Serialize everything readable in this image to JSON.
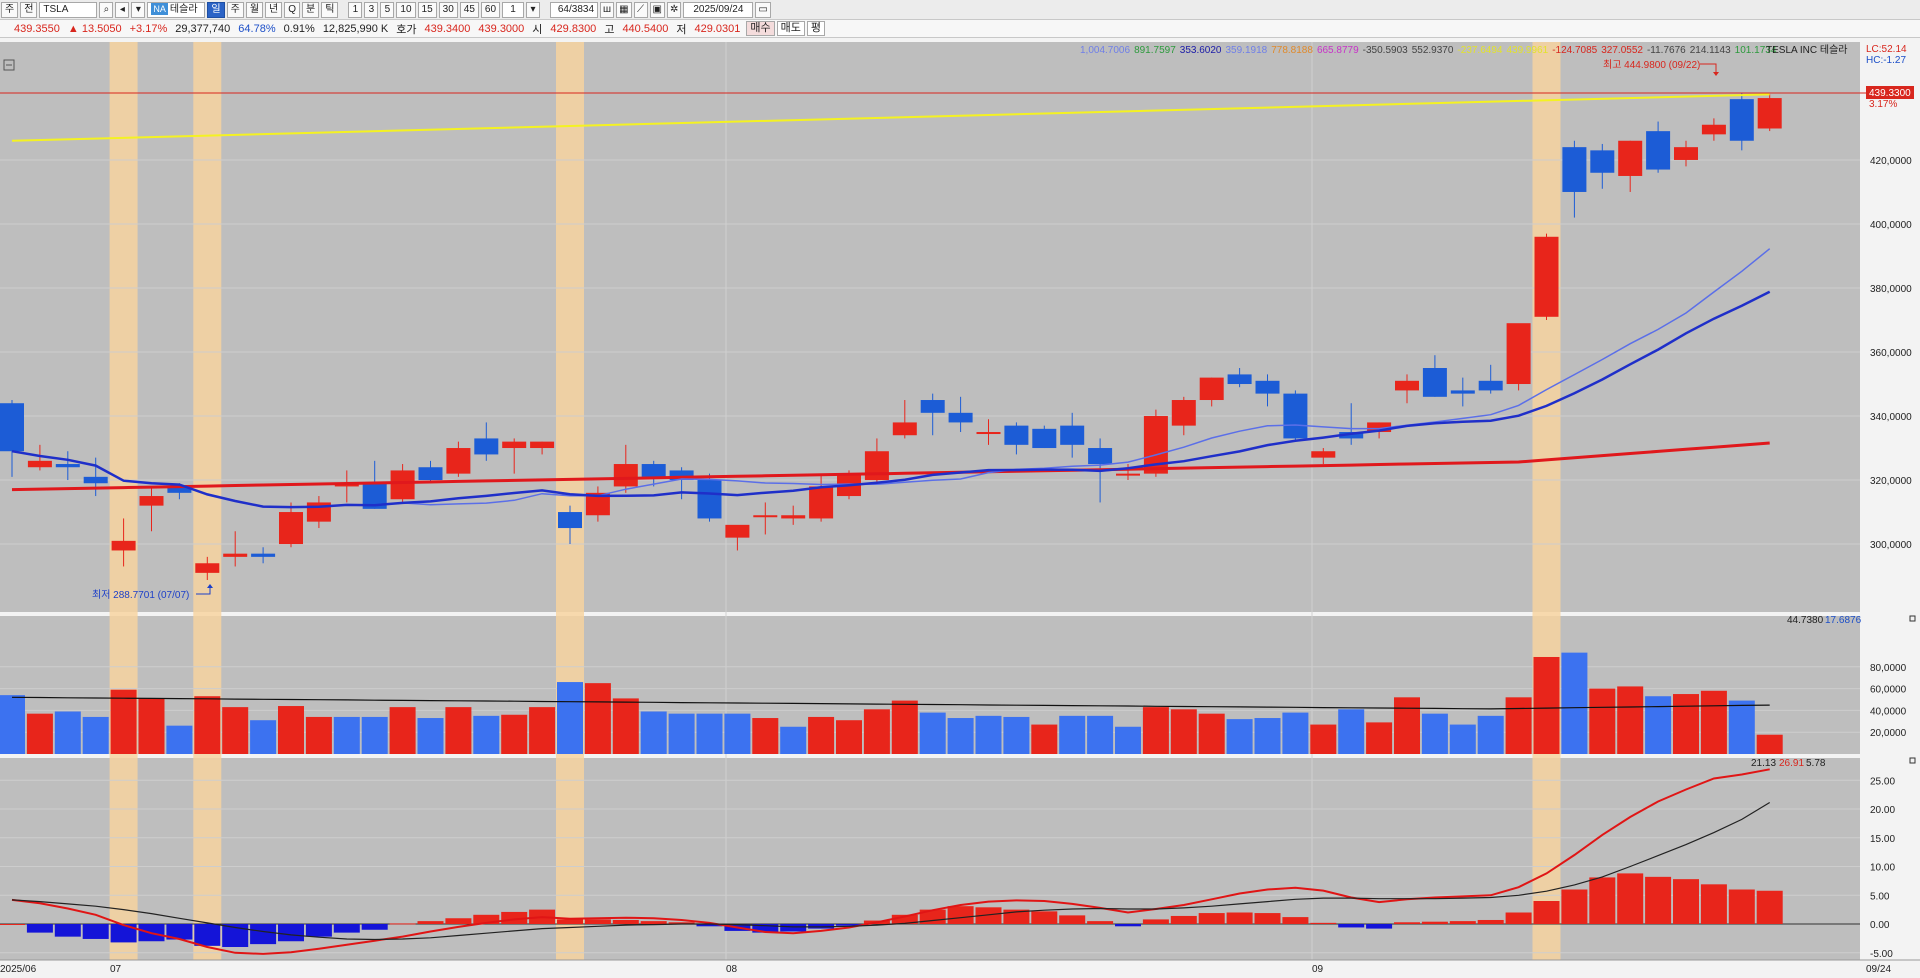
{
  "toolbar": {
    "period_type": "주",
    "prev": "전",
    "symbol": "TSLA",
    "na_badge": "NA",
    "stock_name": "테슬라",
    "periods": [
      "일",
      "주",
      "월",
      "년",
      "Q",
      "분",
      "틱"
    ],
    "active_period": "일",
    "minute_steps": [
      "1",
      "3",
      "5",
      "10",
      "15",
      "30",
      "45",
      "60"
    ],
    "step_value": "1",
    "counter": "64",
    "total": "/3834",
    "date": "2025/09/24"
  },
  "quote": {
    "price": "439.3550",
    "change": "▲ 13.5050",
    "change_pct": "+3.17%",
    "volume": "29,377,740",
    "volume_pct": "64.78%",
    "turnover_pct": "0.91%",
    "amount": "12,825,990 K",
    "hoga_label": "호가",
    "ask": "439.3400",
    "bid": "439.3000",
    "open_label": "시",
    "open": "429.8300",
    "high_label": "고",
    "high": "440.5400",
    "low_label": "저",
    "low": "429.0301",
    "buy_label": "매수",
    "sell_label": "매도",
    "avg_label": "평"
  },
  "legend": {
    "values": [
      {
        "text": "1,004.7006",
        "color": "#6f7fe8"
      },
      {
        "text": "891.7597",
        "color": "#2c9a3c"
      },
      {
        "text": "353.6020",
        "color": "#1b1ba8"
      },
      {
        "text": "359.1918",
        "color": "#6f7fe8"
      },
      {
        "text": "778.8188",
        "color": "#e08a2b"
      },
      {
        "text": "665.8779",
        "color": "#c833c8"
      },
      {
        "text": "-350.5903",
        "color": "#444444"
      },
      {
        "text": "552.9370",
        "color": "#444444"
      },
      {
        "text": "-237.6494",
        "color": "#e3e32b"
      },
      {
        "text": "439.9961",
        "color": "#e3e32b"
      },
      {
        "text": "-124.7085",
        "color": "#d8261d"
      },
      {
        "text": "327.0552",
        "color": "#d8261d"
      },
      {
        "text": "-11.7676",
        "color": "#444444"
      },
      {
        "text": "214.1143",
        "color": "#444444"
      },
      {
        "text": "101.1734",
        "color": "#2c9a3c"
      }
    ],
    "name": "TESLA INC  테슬라",
    "lc": "LC:52.14",
    "hc": "HC:-1.27"
  },
  "price_panel": {
    "y_ticks": [
      "420,0000",
      "400,0000",
      "380,0000",
      "360,0000",
      "340,0000",
      "320,0000",
      "300,0000"
    ],
    "current_price": "439.3300",
    "current_pct": "3.17%",
    "high_note": "최고 444.9800 (09/22)",
    "low_note": "최저 288.7701 (07/07)"
  },
  "volume_panel": {
    "header_a": "44.7380",
    "header_b": "17.6876",
    "y_ticks": [
      "80,0000",
      "60,0000",
      "40,0000",
      "20,0000"
    ]
  },
  "macd_panel": {
    "header_a": "21.13",
    "header_b": "26.91",
    "header_c": "5.78",
    "y_ticks": [
      "25.00",
      "20.00",
      "15.00",
      "10.00",
      "5.00",
      "0.00",
      "-5.00"
    ]
  },
  "x_labels": [
    "2025/06",
    "07",
    "08",
    "09",
    "09/24"
  ],
  "colors": {
    "up": "#e8251b",
    "down": "#1c5cd6",
    "vol_down": "#3c72f0",
    "highlight": "#f7d3a0",
    "background": "#bfbfbf",
    "ma_red": "#e0181c",
    "ma_blue": "#1f2fc9",
    "ma_light": "#5b6fe8",
    "ma_yellow": "#f4f222"
  },
  "chart_data": {
    "type": "candlestick",
    "candles": [
      {
        "o": 344,
        "h": 345,
        "l": 321,
        "c": 329
      },
      {
        "o": 324,
        "h": 331,
        "l": 323,
        "c": 326
      },
      {
        "o": 325,
        "h": 329,
        "l": 320,
        "c": 324
      },
      {
        "o": 321,
        "h": 327,
        "l": 315,
        "c": 319
      },
      {
        "o": 298,
        "h": 308,
        "l": 293,
        "c": 301
      },
      {
        "o": 312,
        "h": 318,
        "l": 304,
        "c": 315
      },
      {
        "o": 318,
        "h": 319,
        "l": 314,
        "c": 316
      },
      {
        "o": 291,
        "h": 296,
        "l": 288.77,
        "c": 294
      },
      {
        "o": 296,
        "h": 304,
        "l": 293,
        "c": 297
      },
      {
        "o": 297,
        "h": 299,
        "l": 294,
        "c": 296
      },
      {
        "o": 300,
        "h": 313,
        "l": 299,
        "c": 310
      },
      {
        "o": 307,
        "h": 315,
        "l": 305,
        "c": 313
      },
      {
        "o": 318,
        "h": 323,
        "l": 313,
        "c": 319
      },
      {
        "o": 319,
        "h": 326,
        "l": 311,
        "c": 311
      },
      {
        "o": 314,
        "h": 325,
        "l": 313,
        "c": 323
      },
      {
        "o": 324,
        "h": 326,
        "l": 319,
        "c": 320
      },
      {
        "o": 322,
        "h": 332,
        "l": 321,
        "c": 330
      },
      {
        "o": 333,
        "h": 338,
        "l": 326,
        "c": 328
      },
      {
        "o": 330,
        "h": 333,
        "l": 322,
        "c": 332
      },
      {
        "o": 330,
        "h": 332,
        "l": 328,
        "c": 332
      },
      {
        "o": 310,
        "h": 312,
        "l": 300,
        "c": 305
      },
      {
        "o": 309,
        "h": 318,
        "l": 307,
        "c": 316
      },
      {
        "o": 318,
        "h": 331,
        "l": 316,
        "c": 325
      },
      {
        "o": 325,
        "h": 326,
        "l": 318,
        "c": 321
      },
      {
        "o": 323,
        "h": 324,
        "l": 314,
        "c": 320
      },
      {
        "o": 320,
        "h": 322,
        "l": 307,
        "c": 308
      },
      {
        "o": 302,
        "h": 305,
        "l": 298,
        "c": 306
      },
      {
        "o": 309,
        "h": 313,
        "l": 303,
        "c": 309
      },
      {
        "o": 308,
        "h": 312,
        "l": 306,
        "c": 309
      },
      {
        "o": 308,
        "h": 322,
        "l": 307,
        "c": 318
      },
      {
        "o": 315,
        "h": 323,
        "l": 314,
        "c": 322
      },
      {
        "o": 320,
        "h": 333,
        "l": 319,
        "c": 329
      },
      {
        "o": 334,
        "h": 345,
        "l": 333,
        "c": 338
      },
      {
        "o": 345,
        "h": 347,
        "l": 334,
        "c": 341
      },
      {
        "o": 341,
        "h": 346,
        "l": 335,
        "c": 338
      },
      {
        "o": 335,
        "h": 339,
        "l": 331,
        "c": 335
      },
      {
        "o": 337,
        "h": 338,
        "l": 328,
        "c": 331
      },
      {
        "o": 336,
        "h": 337,
        "l": 330,
        "c": 330
      },
      {
        "o": 337,
        "h": 341,
        "l": 327,
        "c": 331
      },
      {
        "o": 330,
        "h": 333,
        "l": 313,
        "c": 325
      },
      {
        "o": 322,
        "h": 325,
        "l": 320,
        "c": 322
      },
      {
        "o": 322,
        "h": 342,
        "l": 321,
        "c": 340
      },
      {
        "o": 337,
        "h": 346,
        "l": 334,
        "c": 345
      },
      {
        "o": 345,
        "h": 352,
        "l": 343,
        "c": 352
      },
      {
        "o": 353,
        "h": 355,
        "l": 349,
        "c": 350
      },
      {
        "o": 351,
        "h": 353,
        "l": 343,
        "c": 347
      },
      {
        "o": 347,
        "h": 348,
        "l": 332,
        "c": 333
      },
      {
        "o": 327,
        "h": 330,
        "l": 325,
        "c": 329
      },
      {
        "o": 335,
        "h": 344,
        "l": 331,
        "c": 333
      },
      {
        "o": 335,
        "h": 338,
        "l": 333,
        "c": 338
      },
      {
        "o": 348,
        "h": 353,
        "l": 344,
        "c": 351
      },
      {
        "o": 355,
        "h": 359,
        "l": 346,
        "c": 346
      },
      {
        "o": 348,
        "h": 352,
        "l": 343,
        "c": 347
      },
      {
        "o": 351,
        "h": 356,
        "l": 347,
        "c": 348
      },
      {
        "o": 350,
        "h": 357,
        "l": 348,
        "c": 369
      },
      {
        "o": 371,
        "h": 397,
        "l": 370,
        "c": 396
      },
      {
        "o": 424,
        "h": 426,
        "l": 402,
        "c": 410
      },
      {
        "o": 423,
        "h": 425,
        "l": 411,
        "c": 416
      },
      {
        "o": 415,
        "h": 426,
        "l": 410,
        "c": 426
      },
      {
        "o": 429,
        "h": 432,
        "l": 416,
        "c": 417
      },
      {
        "o": 420,
        "h": 426,
        "l": 418,
        "c": 424
      },
      {
        "o": 428,
        "h": 433,
        "l": 426,
        "c": 431
      },
      {
        "o": 439,
        "h": 441,
        "l": 423,
        "c": 426
      },
      {
        "o": 429.83,
        "h": 440.54,
        "l": 429.03,
        "c": 439.33
      }
    ],
    "volume": [
      {
        "v": 54,
        "up": false
      },
      {
        "v": 37,
        "up": true
      },
      {
        "v": 39,
        "up": false
      },
      {
        "v": 34,
        "up": false
      },
      {
        "v": 59,
        "up": true
      },
      {
        "v": 51,
        "up": true
      },
      {
        "v": 26,
        "up": false
      },
      {
        "v": 53,
        "up": true
      },
      {
        "v": 43,
        "up": true
      },
      {
        "v": 31,
        "up": false
      },
      {
        "v": 44,
        "up": true
      },
      {
        "v": 34,
        "up": true
      },
      {
        "v": 34,
        "up": false
      },
      {
        "v": 34,
        "up": false
      },
      {
        "v": 43,
        "up": true
      },
      {
        "v": 33,
        "up": false
      },
      {
        "v": 43,
        "up": true
      },
      {
        "v": 35,
        "up": false
      },
      {
        "v": 36,
        "up": true
      },
      {
        "v": 43,
        "up": true
      },
      {
        "v": 66,
        "up": false
      },
      {
        "v": 65,
        "up": true
      },
      {
        "v": 51,
        "up": true
      },
      {
        "v": 39,
        "up": false
      },
      {
        "v": 37,
        "up": false
      },
      {
        "v": 37,
        "up": false
      },
      {
        "v": 37,
        "up": false
      },
      {
        "v": 33,
        "up": true
      },
      {
        "v": 25,
        "up": false
      },
      {
        "v": 34,
        "up": true
      },
      {
        "v": 31,
        "up": true
      },
      {
        "v": 41,
        "up": true
      },
      {
        "v": 49,
        "up": true
      },
      {
        "v": 38,
        "up": false
      },
      {
        "v": 33,
        "up": false
      },
      {
        "v": 35,
        "up": false
      },
      {
        "v": 34,
        "up": false
      },
      {
        "v": 27,
        "up": true
      },
      {
        "v": 35,
        "up": false
      },
      {
        "v": 35,
        "up": false
      },
      {
        "v": 25,
        "up": false
      },
      {
        "v": 43,
        "up": true
      },
      {
        "v": 41,
        "up": true
      },
      {
        "v": 37,
        "up": true
      },
      {
        "v": 32,
        "up": false
      },
      {
        "v": 33,
        "up": false
      },
      {
        "v": 38,
        "up": false
      },
      {
        "v": 27,
        "up": true
      },
      {
        "v": 41,
        "up": false
      },
      {
        "v": 29,
        "up": true
      },
      {
        "v": 52,
        "up": true
      },
      {
        "v": 37,
        "up": false
      },
      {
        "v": 27,
        "up": false
      },
      {
        "v": 35,
        "up": false
      },
      {
        "v": 52,
        "up": true
      },
      {
        "v": 89,
        "up": true
      },
      {
        "v": 93,
        "up": false
      },
      {
        "v": 60,
        "up": true
      },
      {
        "v": 62,
        "up": true
      },
      {
        "v": 53,
        "up": false
      },
      {
        "v": 55,
        "up": true
      },
      {
        "v": 58,
        "up": true
      },
      {
        "v": 49,
        "up": false
      },
      {
        "v": 17.69,
        "up": true
      }
    ],
    "macd_hist": [
      0,
      -1.5,
      -2.2,
      -2.6,
      -3.2,
      -3.0,
      -2.7,
      -3.8,
      -4.0,
      -3.5,
      -3.0,
      -2.2,
      -1.5,
      -1.0,
      0.1,
      0.5,
      1.0,
      1.6,
      2.1,
      2.5,
      0.8,
      0.8,
      0.7,
      0.5,
      0.3,
      -0.4,
      -1.2,
      -1.5,
      -1.3,
      -0.8,
      -0.3,
      0.6,
      1.6,
      2.5,
      3.1,
      2.9,
      2.5,
      2.2,
      1.5,
      0.5,
      -0.4,
      0.8,
      1.4,
      1.9,
      2.0,
      1.9,
      1.2,
      0.2,
      -0.6,
      -0.8,
      0.3,
      0.4,
      0.5,
      0.7,
      2.0,
      4.0,
      6.0,
      8.1,
      8.8,
      8.2,
      7.8,
      6.9,
      6.0,
      5.78
    ],
    "macd_line": [
      4.2,
      3.6,
      2.7,
      1.6,
      -0.2,
      -1.6,
      -2.6,
      -4.0,
      -5.0,
      -5.2,
      -4.9,
      -4.3,
      -3.6,
      -2.9,
      -2.2,
      -1.3,
      -0.5,
      0.2,
      0.8,
      1.2,
      0.9,
      1.0,
      1.1,
      1.0,
      0.7,
      0.2,
      -0.6,
      -1.4,
      -1.6,
      -1.2,
      -0.6,
      0.3,
      1.3,
      2.4,
      3.3,
      3.9,
      4.1,
      4.0,
      3.5,
      2.8,
      2.0,
      2.6,
      3.3,
      4.3,
      5.3,
      6.0,
      6.3,
      5.8,
      4.6,
      3.8,
      4.3,
      4.6,
      4.8,
      5.0,
      6.4,
      8.8,
      12.0,
      15.5,
      18.6,
      21.3,
      23.4,
      25.3,
      26.0,
      26.91
    ],
    "signal_line": [
      4.2,
      3.9,
      3.5,
      3.1,
      2.5,
      1.8,
      1.0,
      0.2,
      -0.6,
      -1.3,
      -1.9,
      -2.3,
      -2.6,
      -2.7,
      -2.6,
      -2.4,
      -2.0,
      -1.6,
      -1.2,
      -0.8,
      -0.6,
      -0.4,
      -0.2,
      -0.1,
      0,
      0,
      -0.1,
      -0.3,
      -0.5,
      -0.5,
      -0.4,
      -0.2,
      0.1,
      0.6,
      1.1,
      1.6,
      2.1,
      2.4,
      2.6,
      2.7,
      2.6,
      2.6,
      2.8,
      3.1,
      3.5,
      3.9,
      4.3,
      4.5,
      4.5,
      4.4,
      4.4,
      4.4,
      4.5,
      4.6,
      5.0,
      5.7,
      6.8,
      8.2,
      10.0,
      11.9,
      13.8,
      15.9,
      18.2,
      21.13
    ]
  }
}
